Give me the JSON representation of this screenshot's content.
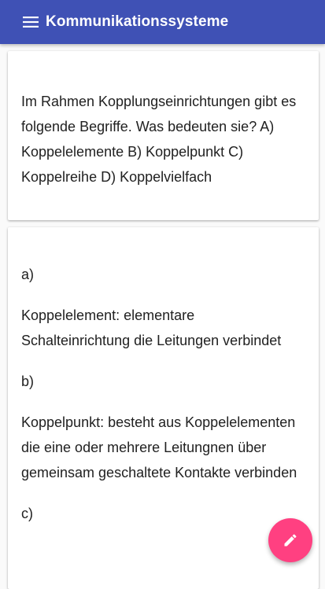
{
  "app_bar": {
    "title": "Kommunikationssysteme",
    "menu_icon": "hamburger-menu-icon",
    "background": "#3f51b5"
  },
  "question": {
    "text": "Im Rahmen Kopplungseinrichtungen gibt es folgende Begriffe. Was bedeuten sie? A) Koppelelemente B) Koppelpunkt C) Koppelreihe D) Koppelvielfach"
  },
  "answer": {
    "lines": [
      "a)",
      "Koppelelement: elementare Schalteinrichtung die Leitungen verbindet",
      "b)",
      "Koppelpunkt: besteht aus Koppelelementen die eine oder mehrere Leitungnen über gemeinsam geschaltete Kontakte verbinden",
      "c)"
    ]
  },
  "fab": {
    "icon": "edit-pencil-icon",
    "color": "#ff4081"
  }
}
